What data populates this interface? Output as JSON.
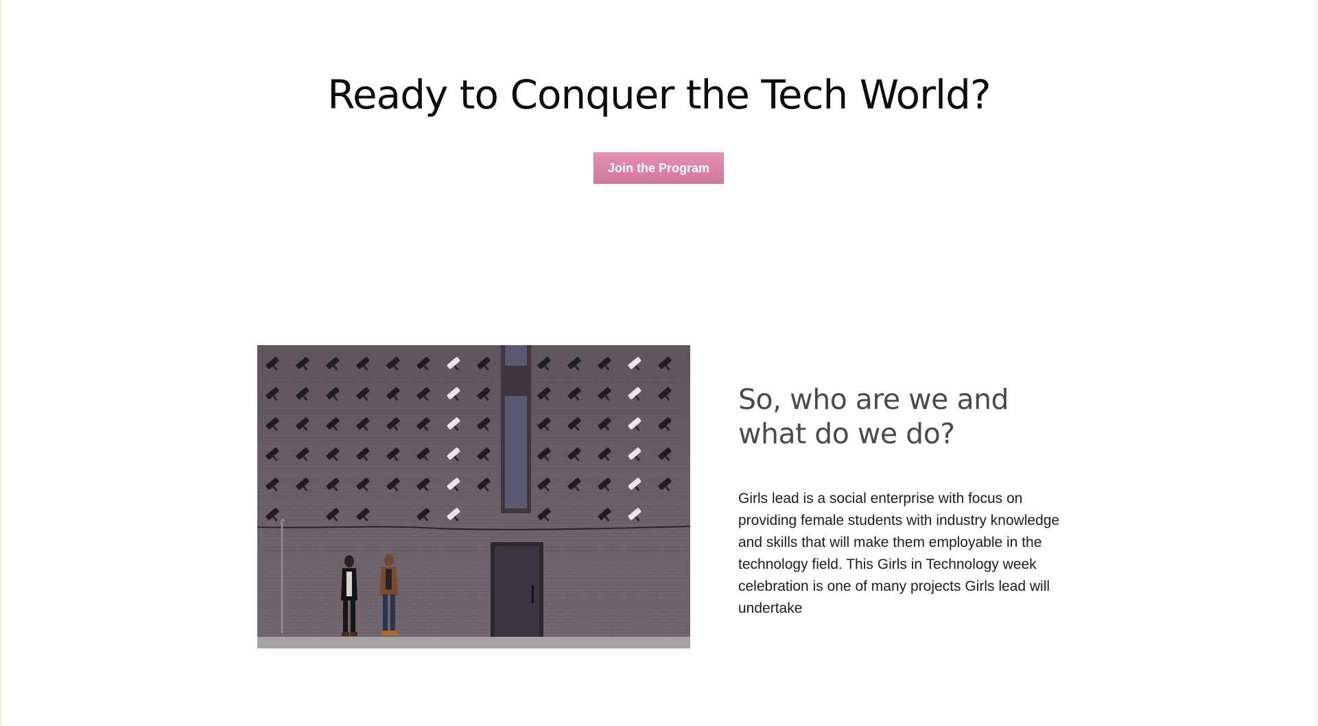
{
  "hero": {
    "title": "Ready to Conquer the Tech World?",
    "cta_label": "Join the Program",
    "cta_color_top": "#e58fb2",
    "cta_color_bottom": "#d0779d"
  },
  "about": {
    "heading": "So, who are we and what do we do?",
    "body": "Girls lead is a social enterprise with focus on providing female students with industry knowledge and skills that will make them employable in the technology field. This Girls in Technology week celebration is one of many projects Girls lead will undertake",
    "image_description": "two-people-looking-up-at-wall-of-security-cameras"
  },
  "colors": {
    "background": "#ffffff",
    "heading_dark": "#0c0c0c",
    "heading_grey": "#4a4a4a",
    "wall": "#6b5f68"
  }
}
